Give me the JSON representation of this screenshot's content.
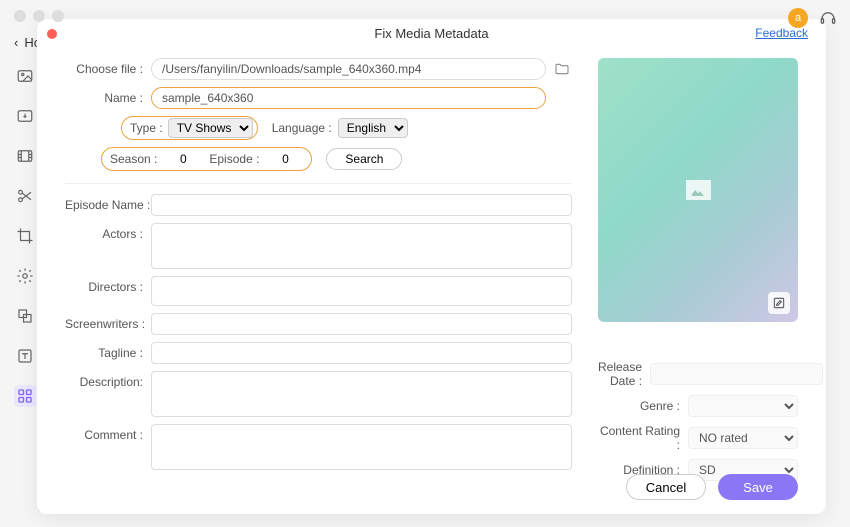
{
  "header": {
    "back_label": "Ho"
  },
  "top_right": {
    "avatar_initial": "a"
  },
  "modal": {
    "title": "Fix Media Metadata",
    "feedback": "Feedback"
  },
  "form": {
    "choose_file_label": "Choose file :",
    "choose_file_value": "/Users/fanyilin/Downloads/sample_640x360.mp4",
    "name_label": "Name :",
    "name_value": "sample_640x360",
    "type_label": "Type :",
    "type_value": "TV Shows",
    "language_label": "Language :",
    "language_value": "English",
    "season_label": "Season :",
    "season_value": "0",
    "episode_label_small": "Episode :",
    "episode_value": "0",
    "search_label": "Search",
    "episode_name_label": "Episode Name :",
    "actors_label": "Actors :",
    "directors_label": "Directors :",
    "screenwriters_label": "Screenwriters :",
    "tagline_label": "Tagline :",
    "description_label": "Description:",
    "comment_label": "Comment :"
  },
  "right": {
    "release_date_label": "Release Date :",
    "genre_label": "Genre :",
    "content_rating_label": "Content Rating :",
    "content_rating_value": "NO rated",
    "definition_label": "Definition :",
    "definition_value": "SD"
  },
  "footer": {
    "cancel": "Cancel",
    "save": "Save"
  }
}
